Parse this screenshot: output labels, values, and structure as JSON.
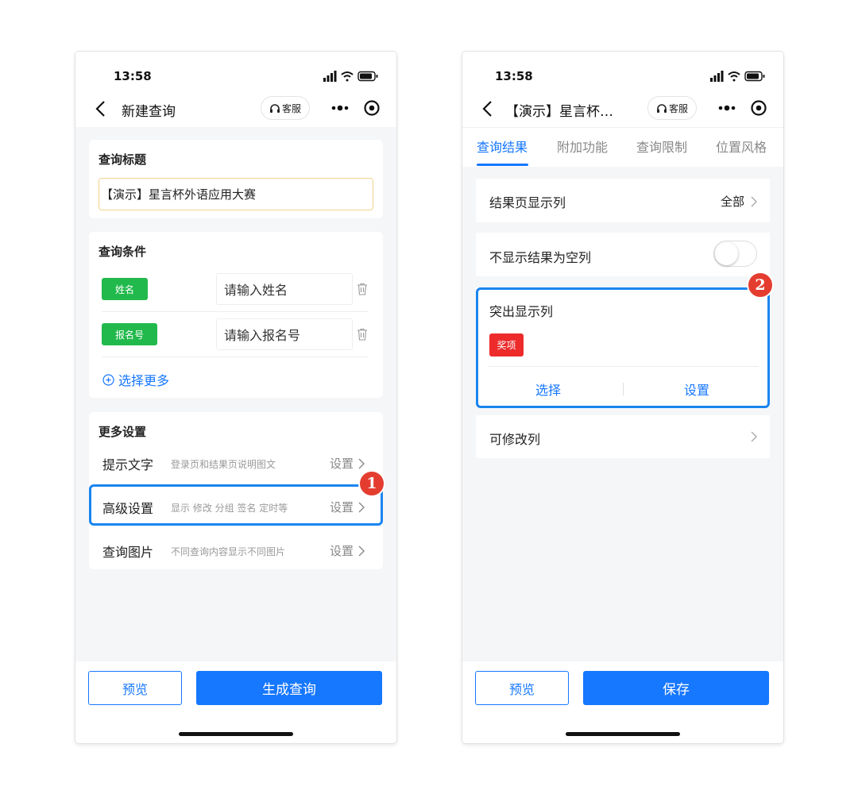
{
  "left_phone": {
    "status_time": "13:58",
    "nav_title": "新建查询",
    "kefu_label": "客服",
    "title_section": {
      "heading": "查询标题",
      "input_value": "【演示】星言杯外语应用大赛"
    },
    "conditions": {
      "heading": "查询条件",
      "items": [
        {
          "tag": "姓名",
          "placeholder": "请输入姓名"
        },
        {
          "tag": "报名号",
          "placeholder": "请输入报名号"
        }
      ],
      "add_more": "选择更多"
    },
    "more_settings": {
      "heading": "更多设置",
      "rows": [
        {
          "label": "提示文字",
          "desc": "登录页和结果页说明图文",
          "action": "设置"
        },
        {
          "label": "高级设置",
          "desc": "显示 修改 分组 签名 定时等",
          "action": "设置"
        },
        {
          "label": "查询图片",
          "desc": "不同查询内容显示不同图片",
          "action": "设置"
        }
      ]
    },
    "badge": "1",
    "preview_label": "预览",
    "primary_label": "生成查询"
  },
  "right_phone": {
    "status_time": "13:58",
    "nav_title": "【演示】星言杯…",
    "kefu_label": "客服",
    "tabs": [
      "查询结果",
      "附加功能",
      "查询限制",
      "位置风格"
    ],
    "active_tab": 0,
    "rows": {
      "result_columns": {
        "label": "结果页显示列",
        "value": "全部"
      },
      "hide_empty": {
        "label": "不显示结果为空列",
        "toggle_on": false
      },
      "highlight": {
        "label": "突出显示列",
        "tag": "奖项",
        "select": "选择",
        "settings": "设置"
      },
      "editable": {
        "label": "可修改列"
      }
    },
    "badge": "2",
    "preview_label": "预览",
    "primary_label": "保存"
  },
  "colors": {
    "accent": "#1677ff",
    "green_tag": "#21b94b",
    "red_tag": "#ed2b2b",
    "badge": "#e43d30",
    "highlight_border": "#1a85ef"
  },
  "icons": [
    "back-arrow-icon",
    "headset-icon",
    "more-dots-icon",
    "target-circle-icon",
    "trash-icon",
    "plus-circle-icon",
    "chevron-right-icon",
    "signal-icon",
    "wifi-icon",
    "battery-icon"
  ]
}
